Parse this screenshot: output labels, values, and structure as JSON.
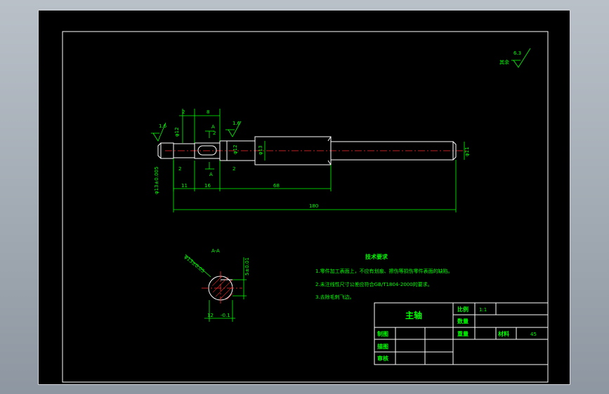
{
  "roughness_note": {
    "value": "6.3",
    "label": "其余"
  },
  "dims_top": {
    "d1": "2",
    "d2": "8",
    "d3": "2",
    "dia_left": "φ12",
    "dia_mid1": "φ12",
    "dia_mid2": "φ13",
    "dia_right": "φ11"
  },
  "roughness_marks": [
    "1.6",
    "1.6"
  ],
  "section_marks": {
    "top": "A",
    "bottom": "A"
  },
  "dims_bottom": {
    "d_left": "2",
    "d_mid": "2",
    "tol": "φ13±0.005",
    "a": "11",
    "b": "16",
    "c": "68",
    "total": "180"
  },
  "section": {
    "title": "A-A",
    "dia_tol": "φ13±0.05",
    "key_width": "5±0.01",
    "key_depth": "12",
    "depth_tol": "-0.1"
  },
  "tech": {
    "title": "技术要求",
    "items": [
      "1.零件加工表面上，不应有划痕、擦伤等损伤零件表面的缺陷。",
      "2.未注线性尺寸公差应符合GB/T1804-2000的要求。",
      "3.去除毛刺飞边。"
    ]
  },
  "title_block": {
    "part_name": "主轴",
    "scale_label": "比例",
    "scale_value": "1:1",
    "qty_label": "数量",
    "weight_label": "重量",
    "material_label": "材料",
    "material_value": "45",
    "drawn_label": "制图",
    "traced_label": "描图",
    "checked_label": "审核"
  }
}
